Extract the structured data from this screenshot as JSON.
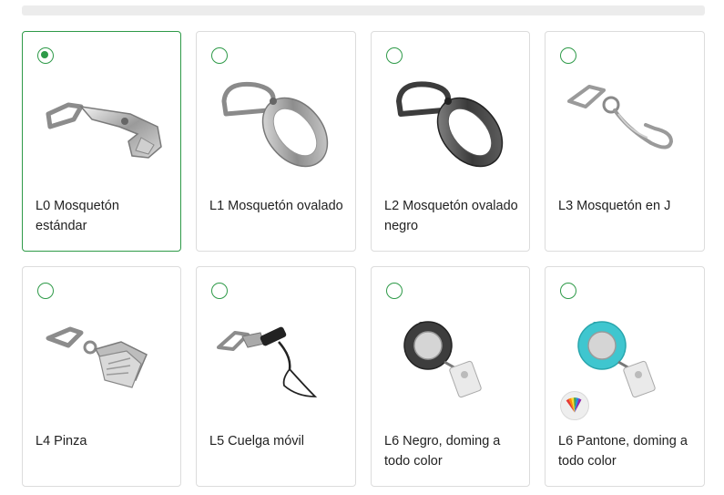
{
  "options": [
    {
      "label": "L0 Mosquetón estándar",
      "selected": true,
      "icon": "standard-carabiner-icon"
    },
    {
      "label": "L1 Mosquetón ovalado",
      "selected": false,
      "icon": "oval-carabiner-icon"
    },
    {
      "label": "L2 Mosquetón ovalado negro",
      "selected": false,
      "icon": "black-oval-carabiner-icon"
    },
    {
      "label": "L3 Mosquetón en J",
      "selected": false,
      "icon": "j-hook-icon"
    },
    {
      "label": "L4 Pinza",
      "selected": false,
      "icon": "clip-icon"
    },
    {
      "label": "L5 Cuelga móvil",
      "selected": false,
      "icon": "phone-strap-icon"
    },
    {
      "label": "L6 Negro, doming a todo color",
      "selected": false,
      "icon": "black-badge-reel-icon"
    },
    {
      "label": "L6 Pantone, doming a todo color",
      "selected": false,
      "icon": "pantone-badge-reel-icon"
    }
  ],
  "colors": {
    "accent": "#2e9a48",
    "reel_teal": "#3fc6cf"
  }
}
